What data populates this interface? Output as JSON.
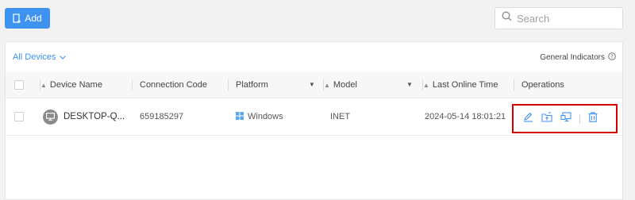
{
  "toolbar": {
    "add_label": "Add"
  },
  "search": {
    "placeholder": "Search",
    "value": ""
  },
  "filter": {
    "label": "All Devices"
  },
  "general_indicators": {
    "label": "General Indicators"
  },
  "table": {
    "columns": {
      "device_name": "Device Name",
      "connection_code": "Connection Code",
      "platform": "Platform",
      "model": "Model",
      "last_online_time": "Last Online Time",
      "operations": "Operations"
    },
    "rows": [
      {
        "device_name": "DESKTOP-Q...",
        "connection_code": "659185297",
        "platform": "Windows",
        "model": "INET",
        "last_online_time": "2024-05-14 18:01:21"
      }
    ]
  },
  "colors": {
    "accent": "#3f93f0",
    "highlight_border": "#d40000",
    "windows_icon": "#5aa9ee"
  },
  "icons": {
    "add": "add-device-icon",
    "search": "search-icon",
    "filter_dropdown": "chevron-down-icon",
    "help": "question-circle-icon",
    "avatar": "monitor-icon",
    "platform": "windows-icon",
    "operations": [
      "edit-icon",
      "folder-transfer-icon",
      "remote-desktop-icon",
      "delete-icon"
    ]
  }
}
